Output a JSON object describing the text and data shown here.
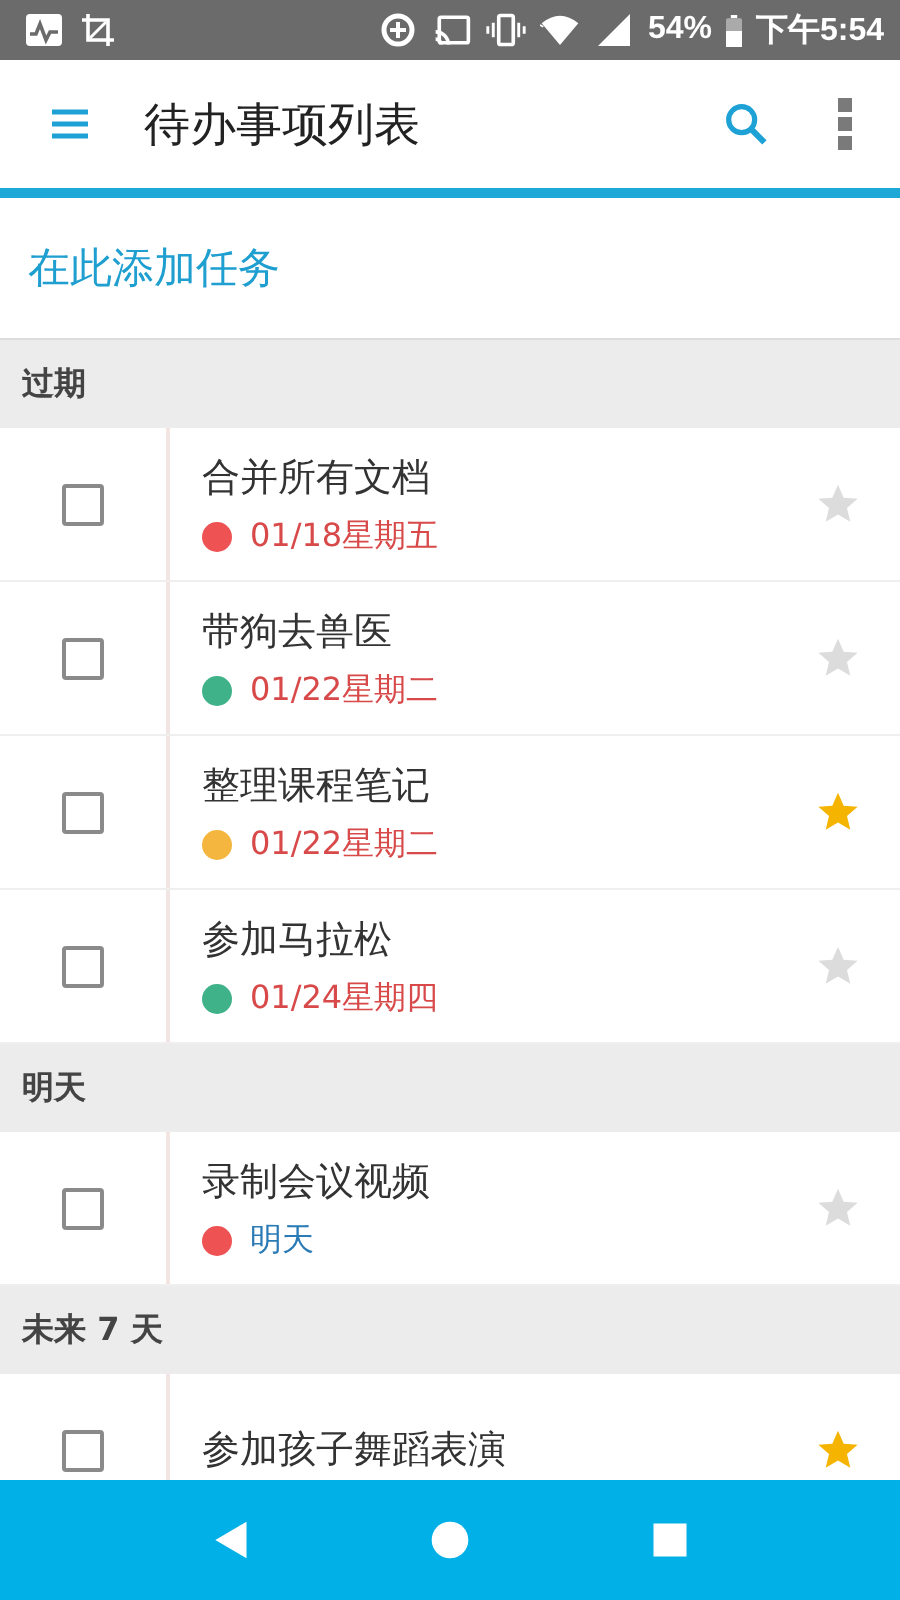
{
  "status_bar": {
    "battery": "54%",
    "time": "下午5:54"
  },
  "app_bar": {
    "title": "待办事项列表"
  },
  "new_task": {
    "placeholder": "在此添加任务"
  },
  "sections": [
    {
      "title": "过期",
      "tasks": [
        {
          "title": "合并所有文档",
          "date": "01/18星期五",
          "overdue": true,
          "color": "#ee5253",
          "checked": false,
          "starred": false
        },
        {
          "title": "带狗去兽医",
          "date": "01/22星期二",
          "overdue": true,
          "color": "#3fb28a",
          "checked": false,
          "starred": false
        },
        {
          "title": "整理课程笔记",
          "date": "01/22星期二",
          "overdue": true,
          "color": "#f4b63f",
          "checked": false,
          "starred": true
        },
        {
          "title": "参加马拉松",
          "date": "01/24星期四",
          "overdue": true,
          "color": "#3fb28a",
          "checked": false,
          "starred": false
        }
      ]
    },
    {
      "title": "明天",
      "tasks": [
        {
          "title": "录制会议视频",
          "date": "明天",
          "overdue": false,
          "color": "#ee5253",
          "checked": false,
          "starred": false
        }
      ]
    },
    {
      "title": "未来 7 天",
      "tasks": [
        {
          "title": "参加孩子舞蹈表演",
          "checked": false,
          "starred": true
        }
      ]
    }
  ]
}
